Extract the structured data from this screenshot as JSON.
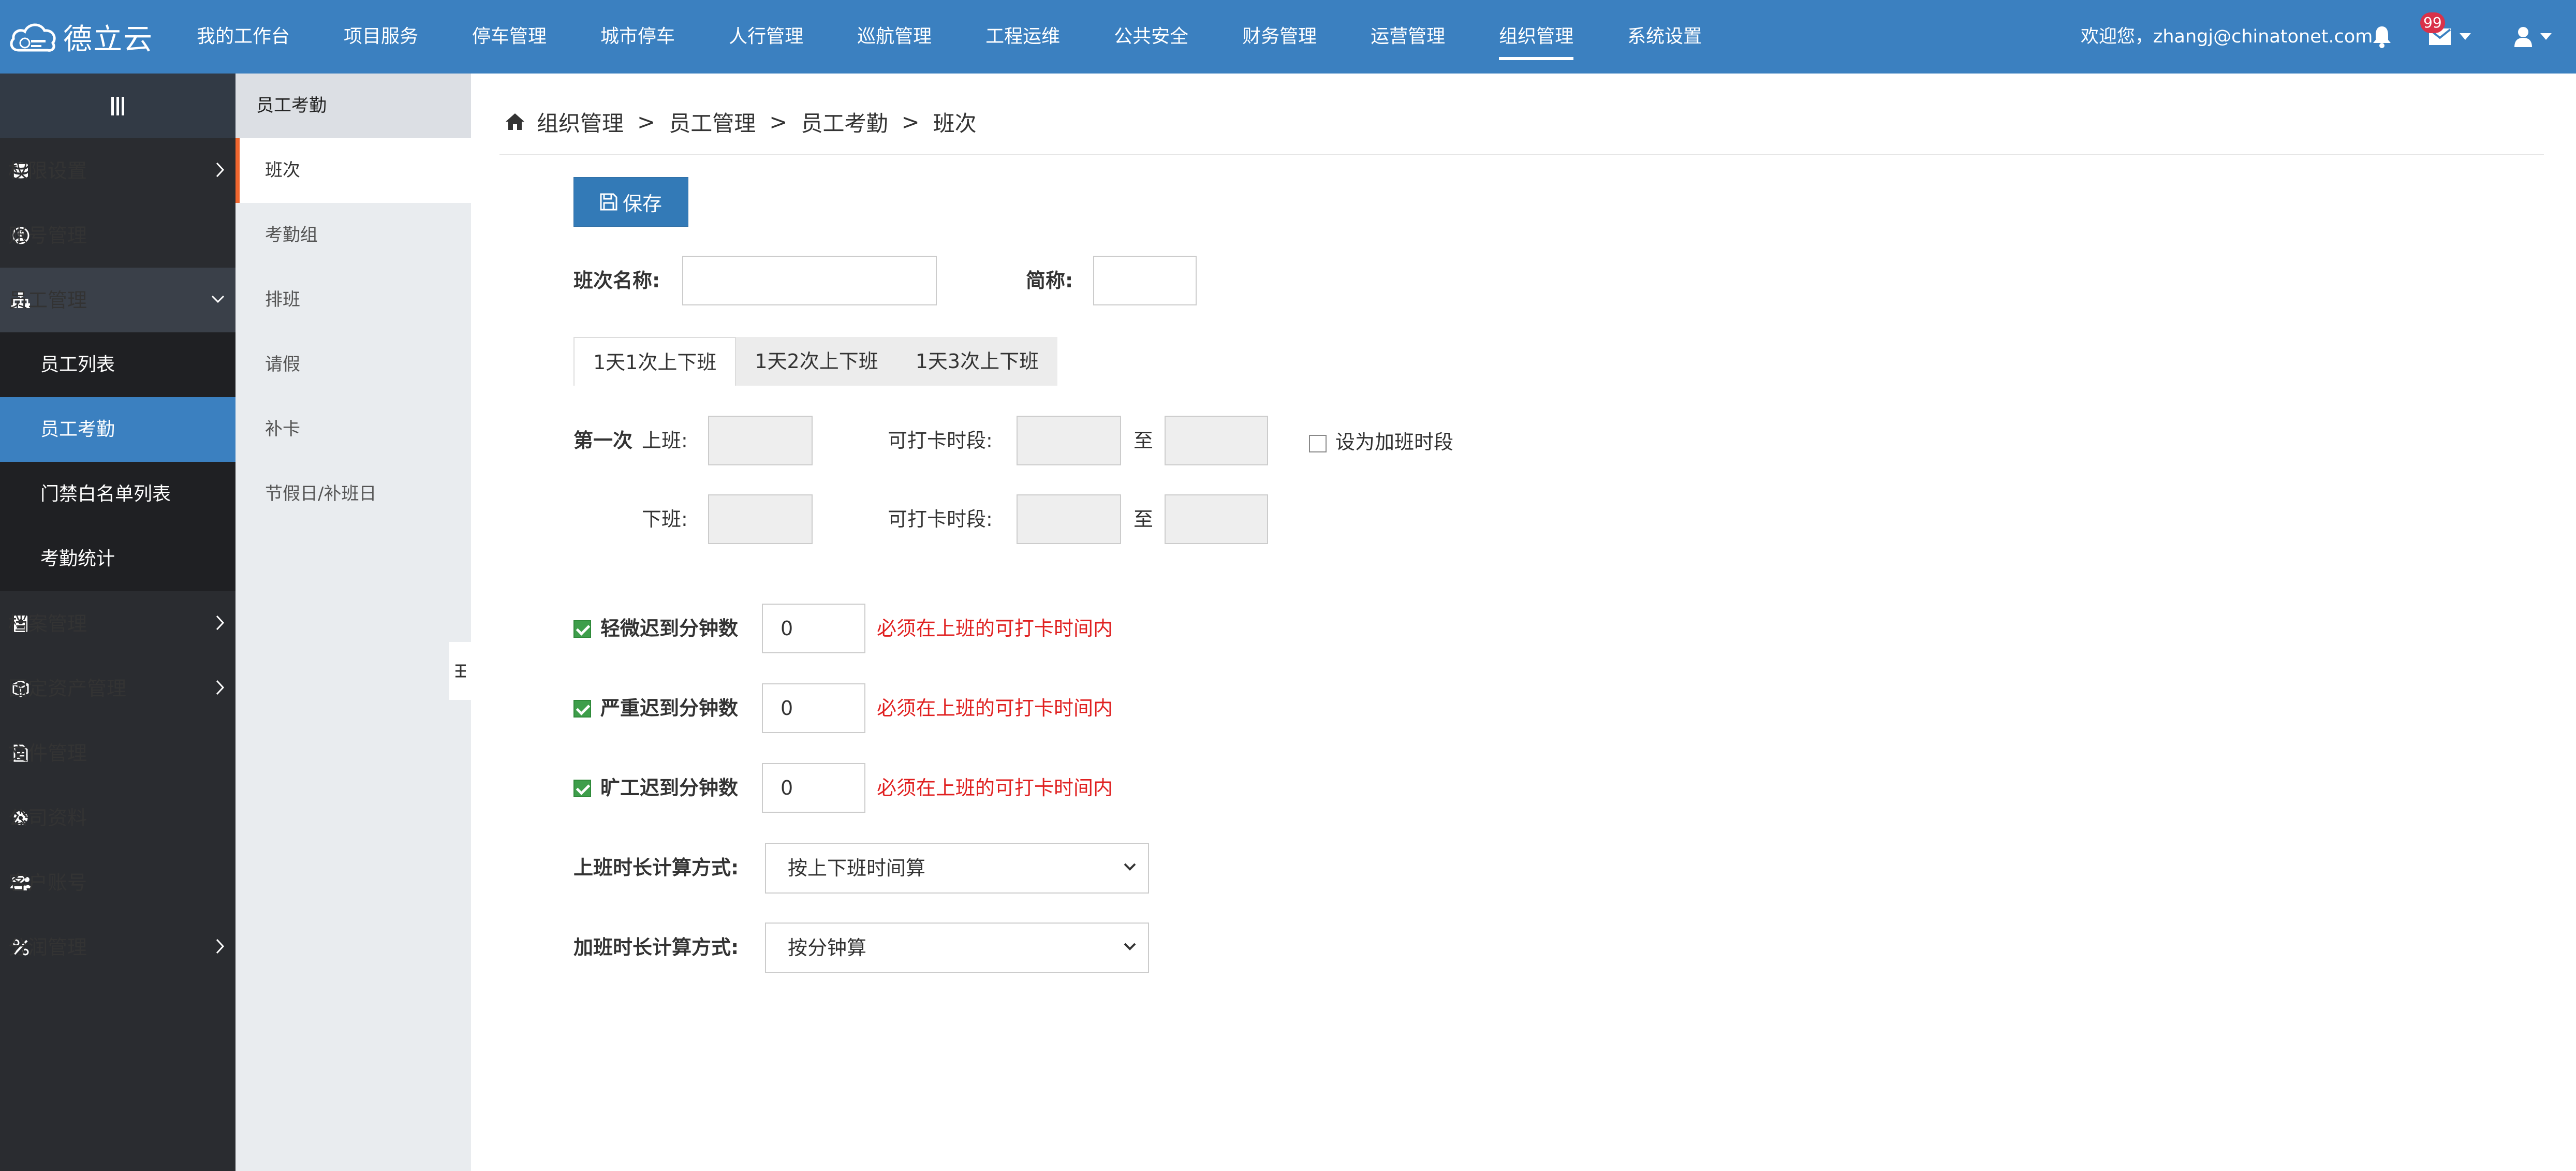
{
  "app": {
    "logo_text": "德立云"
  },
  "topnav": [
    {
      "label": "我的工作台"
    },
    {
      "label": "项目服务"
    },
    {
      "label": "停车管理"
    },
    {
      "label": "城市停车"
    },
    {
      "label": "人行管理"
    },
    {
      "label": "巡航管理"
    },
    {
      "label": "工程运维"
    },
    {
      "label": "公共安全"
    },
    {
      "label": "财务管理"
    },
    {
      "label": "运营管理"
    },
    {
      "label": "组织管理"
    },
    {
      "label": "系统设置"
    }
  ],
  "user": {
    "welcome": "欢迎您，zhangj@chinatonet.com",
    "mail_badge": "99"
  },
  "sidebar": {
    "items": [
      {
        "label": "权限设置",
        "icon": "database-icon"
      },
      {
        "label": "账号管理",
        "icon": "user-circle-icon"
      },
      {
        "label": "员工管理",
        "icon": "sitemap-icon"
      },
      {
        "label": "档案管理",
        "icon": "contact-book-icon"
      },
      {
        "label": "固定资产管理",
        "icon": "cube-icon"
      },
      {
        "label": "文件管理",
        "icon": "file-text-icon"
      },
      {
        "label": "公司资料",
        "icon": "gear-icon"
      },
      {
        "label": "客户账号",
        "icon": "users-icon"
      },
      {
        "label": "分润管理",
        "icon": "percent-icon"
      }
    ],
    "sub_items": [
      {
        "label": "员工列表"
      },
      {
        "label": "员工考勤"
      },
      {
        "label": "门禁白名单列表"
      },
      {
        "label": "考勤统计"
      }
    ]
  },
  "subnav": {
    "title": "员工考勤",
    "items": [
      {
        "label": "班次"
      },
      {
        "label": "考勤组"
      },
      {
        "label": "排班"
      },
      {
        "label": "请假"
      },
      {
        "label": "补卡"
      },
      {
        "label": "节假日/补班日"
      }
    ]
  },
  "breadcrumb": [
    "组织管理",
    "员工管理",
    "员工考勤",
    "班次"
  ],
  "breadcrumb_sep": ">",
  "form": {
    "save_label": "保存",
    "shift_name_label": "班次名称:",
    "shift_name_value": "",
    "short_name_label": "简称:",
    "short_name_value": "",
    "tabs": [
      {
        "label": "1天1次上下班",
        "active": true
      },
      {
        "label": "1天2次上下班",
        "active": false
      },
      {
        "label": "1天3次上下班",
        "active": false
      }
    ],
    "first_label": "第一次",
    "on_duty_label": "上班:",
    "off_duty_label": "下班:",
    "punch_window_label": "可打卡时段:",
    "to_label": "至",
    "overtime_label": "设为加班时段",
    "overtime_checked": false,
    "rules": [
      {
        "label": "轻微迟到分钟数",
        "value": "0",
        "hint": "必须在上班的可打卡时间内",
        "checked": true
      },
      {
        "label": "严重迟到分钟数",
        "value": "0",
        "hint": "必须在上班的可打卡时间内",
        "checked": true
      },
      {
        "label": "旷工迟到分钟数",
        "value": "0",
        "hint": "必须在上班的可打卡时间内",
        "checked": true
      }
    ],
    "work_calc_label": "上班时长计算方式:",
    "work_calc_value": "按上下班时间算",
    "overtime_calc_label": "加班时长计算方式:",
    "overtime_calc_value": "按分钟算"
  },
  "colors": {
    "topbar": "#3b80c0",
    "sidebar": "#2a2c30",
    "active_sub": "#3b80c0",
    "subnav_accent": "#f0662e",
    "hint": "#e02020",
    "checkbox": "#3e9e4b"
  }
}
